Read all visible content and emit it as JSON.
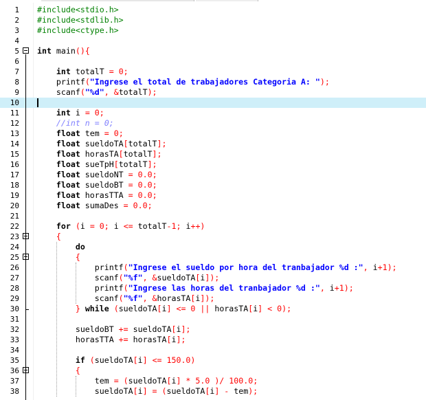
{
  "editor": {
    "lines": [
      {
        "n": "1",
        "t": [
          [
            "pp",
            "#include<stdio.h>"
          ]
        ]
      },
      {
        "n": "2",
        "t": [
          [
            "pp",
            "#include<stdlib.h>"
          ]
        ]
      },
      {
        "n": "3",
        "t": [
          [
            "pp",
            "#include<ctype.h>"
          ]
        ]
      },
      {
        "n": "4",
        "t": []
      },
      {
        "n": "5",
        "t": [
          [
            "kw",
            "int"
          ],
          [
            "id",
            " main"
          ],
          [
            "sym",
            "(){"
          ]
        ]
      },
      {
        "n": "6",
        "t": []
      },
      {
        "n": "7",
        "t": [
          [
            "id",
            "    "
          ],
          [
            "kw",
            "int"
          ],
          [
            "id",
            " totalT "
          ],
          [
            "sym",
            "="
          ],
          [
            "id",
            " "
          ],
          [
            "num",
            "0"
          ],
          [
            "sym",
            ";"
          ]
        ]
      },
      {
        "n": "8",
        "t": [
          [
            "id",
            "    printf"
          ],
          [
            "sym",
            "("
          ],
          [
            "str",
            "\"Ingrese el total de trabajadores Categoria A: \""
          ],
          [
            "sym",
            ");"
          ]
        ]
      },
      {
        "n": "9",
        "t": [
          [
            "id",
            "    scanf"
          ],
          [
            "sym",
            "("
          ],
          [
            "str",
            "\"%d\""
          ],
          [
            "sym",
            ","
          ],
          [
            "id",
            " "
          ],
          [
            "sym",
            "&"
          ],
          [
            "id",
            "totalT"
          ],
          [
            "sym",
            ");"
          ]
        ]
      },
      {
        "n": "10",
        "t": [],
        "current": true
      },
      {
        "n": "11",
        "t": [
          [
            "id",
            "    "
          ],
          [
            "kw",
            "int"
          ],
          [
            "id",
            " i "
          ],
          [
            "sym",
            "="
          ],
          [
            "id",
            " "
          ],
          [
            "num",
            "0"
          ],
          [
            "sym",
            ";"
          ]
        ]
      },
      {
        "n": "12",
        "t": [
          [
            "id",
            "    "
          ],
          [
            "cmt",
            "//int n = 0;"
          ]
        ]
      },
      {
        "n": "13",
        "t": [
          [
            "id",
            "    "
          ],
          [
            "kw",
            "float"
          ],
          [
            "id",
            " tem "
          ],
          [
            "sym",
            "="
          ],
          [
            "id",
            " "
          ],
          [
            "num",
            "0"
          ],
          [
            "sym",
            ";"
          ]
        ]
      },
      {
        "n": "14",
        "t": [
          [
            "id",
            "    "
          ],
          [
            "kw",
            "float"
          ],
          [
            "id",
            " sueldoTA"
          ],
          [
            "sym",
            "["
          ],
          [
            "id",
            "totalT"
          ],
          [
            "sym",
            "];"
          ]
        ]
      },
      {
        "n": "15",
        "t": [
          [
            "id",
            "    "
          ],
          [
            "kw",
            "float"
          ],
          [
            "id",
            " horasTA"
          ],
          [
            "sym",
            "["
          ],
          [
            "id",
            "totalT"
          ],
          [
            "sym",
            "];"
          ]
        ]
      },
      {
        "n": "16",
        "t": [
          [
            "id",
            "    "
          ],
          [
            "kw",
            "float"
          ],
          [
            "id",
            " sueTpH"
          ],
          [
            "sym",
            "["
          ],
          [
            "id",
            "totalT"
          ],
          [
            "sym",
            "];"
          ]
        ]
      },
      {
        "n": "17",
        "t": [
          [
            "id",
            "    "
          ],
          [
            "kw",
            "float"
          ],
          [
            "id",
            " sueldoNT "
          ],
          [
            "sym",
            "="
          ],
          [
            "id",
            " "
          ],
          [
            "num",
            "0.0"
          ],
          [
            "sym",
            ";"
          ]
        ]
      },
      {
        "n": "18",
        "t": [
          [
            "id",
            "    "
          ],
          [
            "kw",
            "float"
          ],
          [
            "id",
            " sueldoBT "
          ],
          [
            "sym",
            "="
          ],
          [
            "id",
            " "
          ],
          [
            "num",
            "0.0"
          ],
          [
            "sym",
            ";"
          ]
        ]
      },
      {
        "n": "19",
        "t": [
          [
            "id",
            "    "
          ],
          [
            "kw",
            "float"
          ],
          [
            "id",
            " horasTTA "
          ],
          [
            "sym",
            "="
          ],
          [
            "id",
            " "
          ],
          [
            "num",
            "0.0"
          ],
          [
            "sym",
            ";"
          ]
        ]
      },
      {
        "n": "20",
        "t": [
          [
            "id",
            "    "
          ],
          [
            "kw",
            "float"
          ],
          [
            "id",
            " sumaDes "
          ],
          [
            "sym",
            "="
          ],
          [
            "id",
            " "
          ],
          [
            "num",
            "0.0"
          ],
          [
            "sym",
            ";"
          ]
        ]
      },
      {
        "n": "21",
        "t": []
      },
      {
        "n": "22",
        "t": [
          [
            "id",
            "    "
          ],
          [
            "kw",
            "for"
          ],
          [
            "id",
            " "
          ],
          [
            "sym",
            "("
          ],
          [
            "id",
            "i "
          ],
          [
            "sym",
            "="
          ],
          [
            "id",
            " "
          ],
          [
            "num",
            "0"
          ],
          [
            "sym",
            ";"
          ],
          [
            "id",
            " i "
          ],
          [
            "sym",
            "<="
          ],
          [
            "id",
            " totalT"
          ],
          [
            "sym",
            "-"
          ],
          [
            "num",
            "1"
          ],
          [
            "sym",
            ";"
          ],
          [
            "id",
            " i"
          ],
          [
            "sym",
            "++)"
          ]
        ]
      },
      {
        "n": "23",
        "t": [
          [
            "id",
            "    "
          ],
          [
            "sym",
            "{"
          ]
        ]
      },
      {
        "n": "24",
        "t": [
          [
            "id",
            "        "
          ],
          [
            "kw",
            "do"
          ]
        ]
      },
      {
        "n": "25",
        "t": [
          [
            "id",
            "        "
          ],
          [
            "sym",
            "{"
          ]
        ]
      },
      {
        "n": "26",
        "t": [
          [
            "id",
            "            printf"
          ],
          [
            "sym",
            "("
          ],
          [
            "str",
            "\"Ingrese el sueldo por hora del tranbajador %d :\""
          ],
          [
            "sym",
            ","
          ],
          [
            "id",
            " i"
          ],
          [
            "sym",
            "+"
          ],
          [
            "num",
            "1"
          ],
          [
            "sym",
            ");"
          ]
        ]
      },
      {
        "n": "27",
        "t": [
          [
            "id",
            "            scanf"
          ],
          [
            "sym",
            "("
          ],
          [
            "str",
            "\"%f\""
          ],
          [
            "sym",
            ","
          ],
          [
            "id",
            " "
          ],
          [
            "sym",
            "&"
          ],
          [
            "id",
            "sueldoTA"
          ],
          [
            "sym",
            "["
          ],
          [
            "id",
            "i"
          ],
          [
            "sym",
            "]);"
          ]
        ]
      },
      {
        "n": "28",
        "t": [
          [
            "id",
            "            printf"
          ],
          [
            "sym",
            "("
          ],
          [
            "str",
            "\"Ingrese las horas del tranbajador %d :\""
          ],
          [
            "sym",
            ","
          ],
          [
            "id",
            " i"
          ],
          [
            "sym",
            "+"
          ],
          [
            "num",
            "1"
          ],
          [
            "sym",
            ");"
          ]
        ]
      },
      {
        "n": "29",
        "t": [
          [
            "id",
            "            scanf"
          ],
          [
            "sym",
            "("
          ],
          [
            "str",
            "\"%f\""
          ],
          [
            "sym",
            ","
          ],
          [
            "id",
            " "
          ],
          [
            "sym",
            "&"
          ],
          [
            "id",
            "horasTA"
          ],
          [
            "sym",
            "["
          ],
          [
            "id",
            "i"
          ],
          [
            "sym",
            "]);"
          ]
        ]
      },
      {
        "n": "30",
        "t": [
          [
            "id",
            "        "
          ],
          [
            "sym",
            "}"
          ],
          [
            "id",
            " "
          ],
          [
            "kw",
            "while"
          ],
          [
            "id",
            " "
          ],
          [
            "sym",
            "("
          ],
          [
            "id",
            "sueldoTA"
          ],
          [
            "sym",
            "["
          ],
          [
            "id",
            "i"
          ],
          [
            "sym",
            "]"
          ],
          [
            "id",
            " "
          ],
          [
            "sym",
            "<="
          ],
          [
            "id",
            " "
          ],
          [
            "num",
            "0"
          ],
          [
            "id",
            " "
          ],
          [
            "sym",
            "||"
          ],
          [
            "id",
            " horasTA"
          ],
          [
            "sym",
            "["
          ],
          [
            "id",
            "i"
          ],
          [
            "sym",
            "]"
          ],
          [
            "id",
            " "
          ],
          [
            "sym",
            "<"
          ],
          [
            "id",
            " "
          ],
          [
            "num",
            "0"
          ],
          [
            "sym",
            ");"
          ]
        ]
      },
      {
        "n": "31",
        "t": []
      },
      {
        "n": "32",
        "t": [
          [
            "id",
            "        sueldoBT "
          ],
          [
            "sym",
            "+="
          ],
          [
            "id",
            " sueldoTA"
          ],
          [
            "sym",
            "["
          ],
          [
            "id",
            "i"
          ],
          [
            "sym",
            "];"
          ]
        ]
      },
      {
        "n": "33",
        "t": [
          [
            "id",
            "        horasTTA "
          ],
          [
            "sym",
            "+="
          ],
          [
            "id",
            " horasTA"
          ],
          [
            "sym",
            "["
          ],
          [
            "id",
            "i"
          ],
          [
            "sym",
            "];"
          ]
        ]
      },
      {
        "n": "34",
        "t": []
      },
      {
        "n": "35",
        "t": [
          [
            "id",
            "        "
          ],
          [
            "kw",
            "if"
          ],
          [
            "id",
            " "
          ],
          [
            "sym",
            "("
          ],
          [
            "id",
            "sueldoTA"
          ],
          [
            "sym",
            "["
          ],
          [
            "id",
            "i"
          ],
          [
            "sym",
            "]"
          ],
          [
            "id",
            " "
          ],
          [
            "sym",
            "<="
          ],
          [
            "id",
            " "
          ],
          [
            "num",
            "150.0"
          ],
          [
            "sym",
            ")"
          ]
        ]
      },
      {
        "n": "36",
        "t": [
          [
            "id",
            "        "
          ],
          [
            "sym",
            "{"
          ]
        ]
      },
      {
        "n": "37",
        "t": [
          [
            "id",
            "            tem "
          ],
          [
            "sym",
            "="
          ],
          [
            "id",
            " "
          ],
          [
            "sym",
            "("
          ],
          [
            "id",
            "sueldoTA"
          ],
          [
            "sym",
            "["
          ],
          [
            "id",
            "i"
          ],
          [
            "sym",
            "]"
          ],
          [
            "id",
            " "
          ],
          [
            "sym",
            "*"
          ],
          [
            "id",
            " "
          ],
          [
            "num",
            "5.0"
          ],
          [
            "id",
            " "
          ],
          [
            "sym",
            ")/"
          ],
          [
            "id",
            " "
          ],
          [
            "num",
            "100.0"
          ],
          [
            "sym",
            ";"
          ]
        ]
      },
      {
        "n": "38",
        "t": [
          [
            "id",
            "            sueldoTA"
          ],
          [
            "sym",
            "["
          ],
          [
            "id",
            "i"
          ],
          [
            "sym",
            "]"
          ],
          [
            "id",
            " "
          ],
          [
            "sym",
            "="
          ],
          [
            "id",
            " "
          ],
          [
            "sym",
            "("
          ],
          [
            "id",
            "sueldoTA"
          ],
          [
            "sym",
            "["
          ],
          [
            "id",
            "i"
          ],
          [
            "sym",
            "]"
          ],
          [
            "id",
            " "
          ],
          [
            "sym",
            "-"
          ],
          [
            "id",
            " tem"
          ],
          [
            "sym",
            ");"
          ]
        ]
      }
    ]
  }
}
